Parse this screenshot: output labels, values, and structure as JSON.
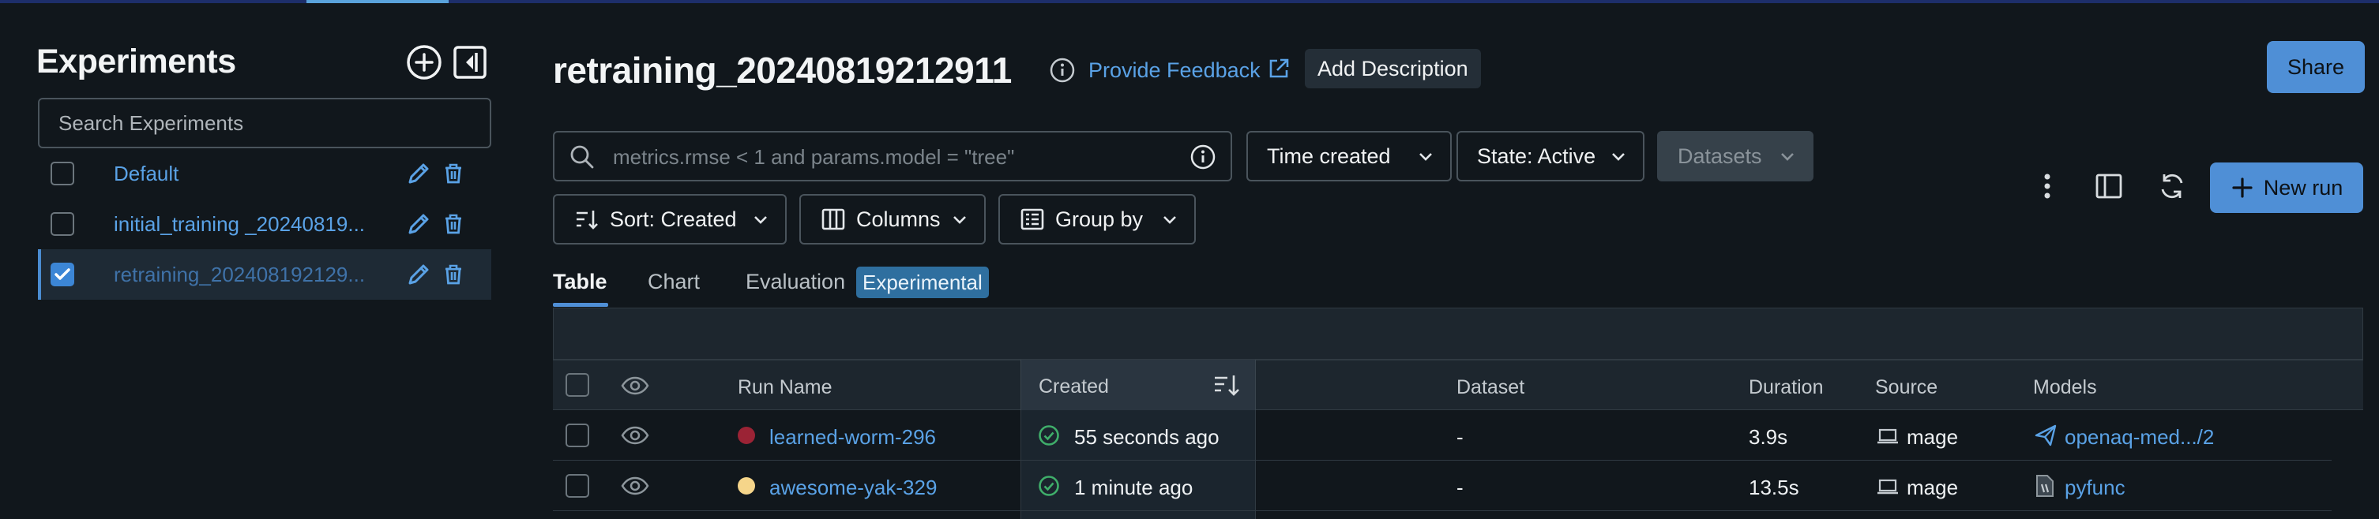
{
  "sidebar": {
    "title": "Experiments",
    "search_placeholder": "Search Experiments",
    "items": [
      {
        "label": "Default",
        "selected": false
      },
      {
        "label": "initial_training _20240819...",
        "selected": false
      },
      {
        "label": "retraining_202408192129...",
        "selected": true
      }
    ]
  },
  "header": {
    "title": "retraining_20240819212911",
    "feedback_label": "Provide Feedback",
    "add_description_label": "Add Description",
    "share_label": "Share"
  },
  "filters": {
    "search_placeholder": "metrics.rmse < 1 and params.model = \"tree\"",
    "time_created": "Time created",
    "state": "State: Active",
    "datasets": "Datasets",
    "sort": "Sort: Created",
    "columns": "Columns",
    "group_by": "Group by"
  },
  "toolbar": {
    "new_run_label": "New run"
  },
  "tabs": {
    "table": "Table",
    "chart": "Chart",
    "evaluation": "Evaluation",
    "experimental_badge": "Experimental"
  },
  "table": {
    "columns": [
      "Run Name",
      "Created",
      "Dataset",
      "Duration",
      "Source",
      "Models"
    ],
    "rows": [
      {
        "run_name": "learned-worm-296",
        "dot_color": "#9b2335",
        "created": "55 seconds ago",
        "dataset": "-",
        "duration": "3.9s",
        "source": "mage",
        "model": "openaq-med.../2",
        "model_icon": "registered-model-icon"
      },
      {
        "run_name": "awesome-yak-329",
        "dot_color": "#f5d58a",
        "created": "1 minute ago",
        "dataset": "-",
        "duration": "13.5s",
        "source": "mage",
        "model": "pyfunc",
        "model_icon": "model-file-icon"
      }
    ]
  },
  "colors": {
    "accent": "#4f8fd6",
    "link": "#5aa2e6",
    "background": "#11171c",
    "success": "#3fae6a"
  }
}
